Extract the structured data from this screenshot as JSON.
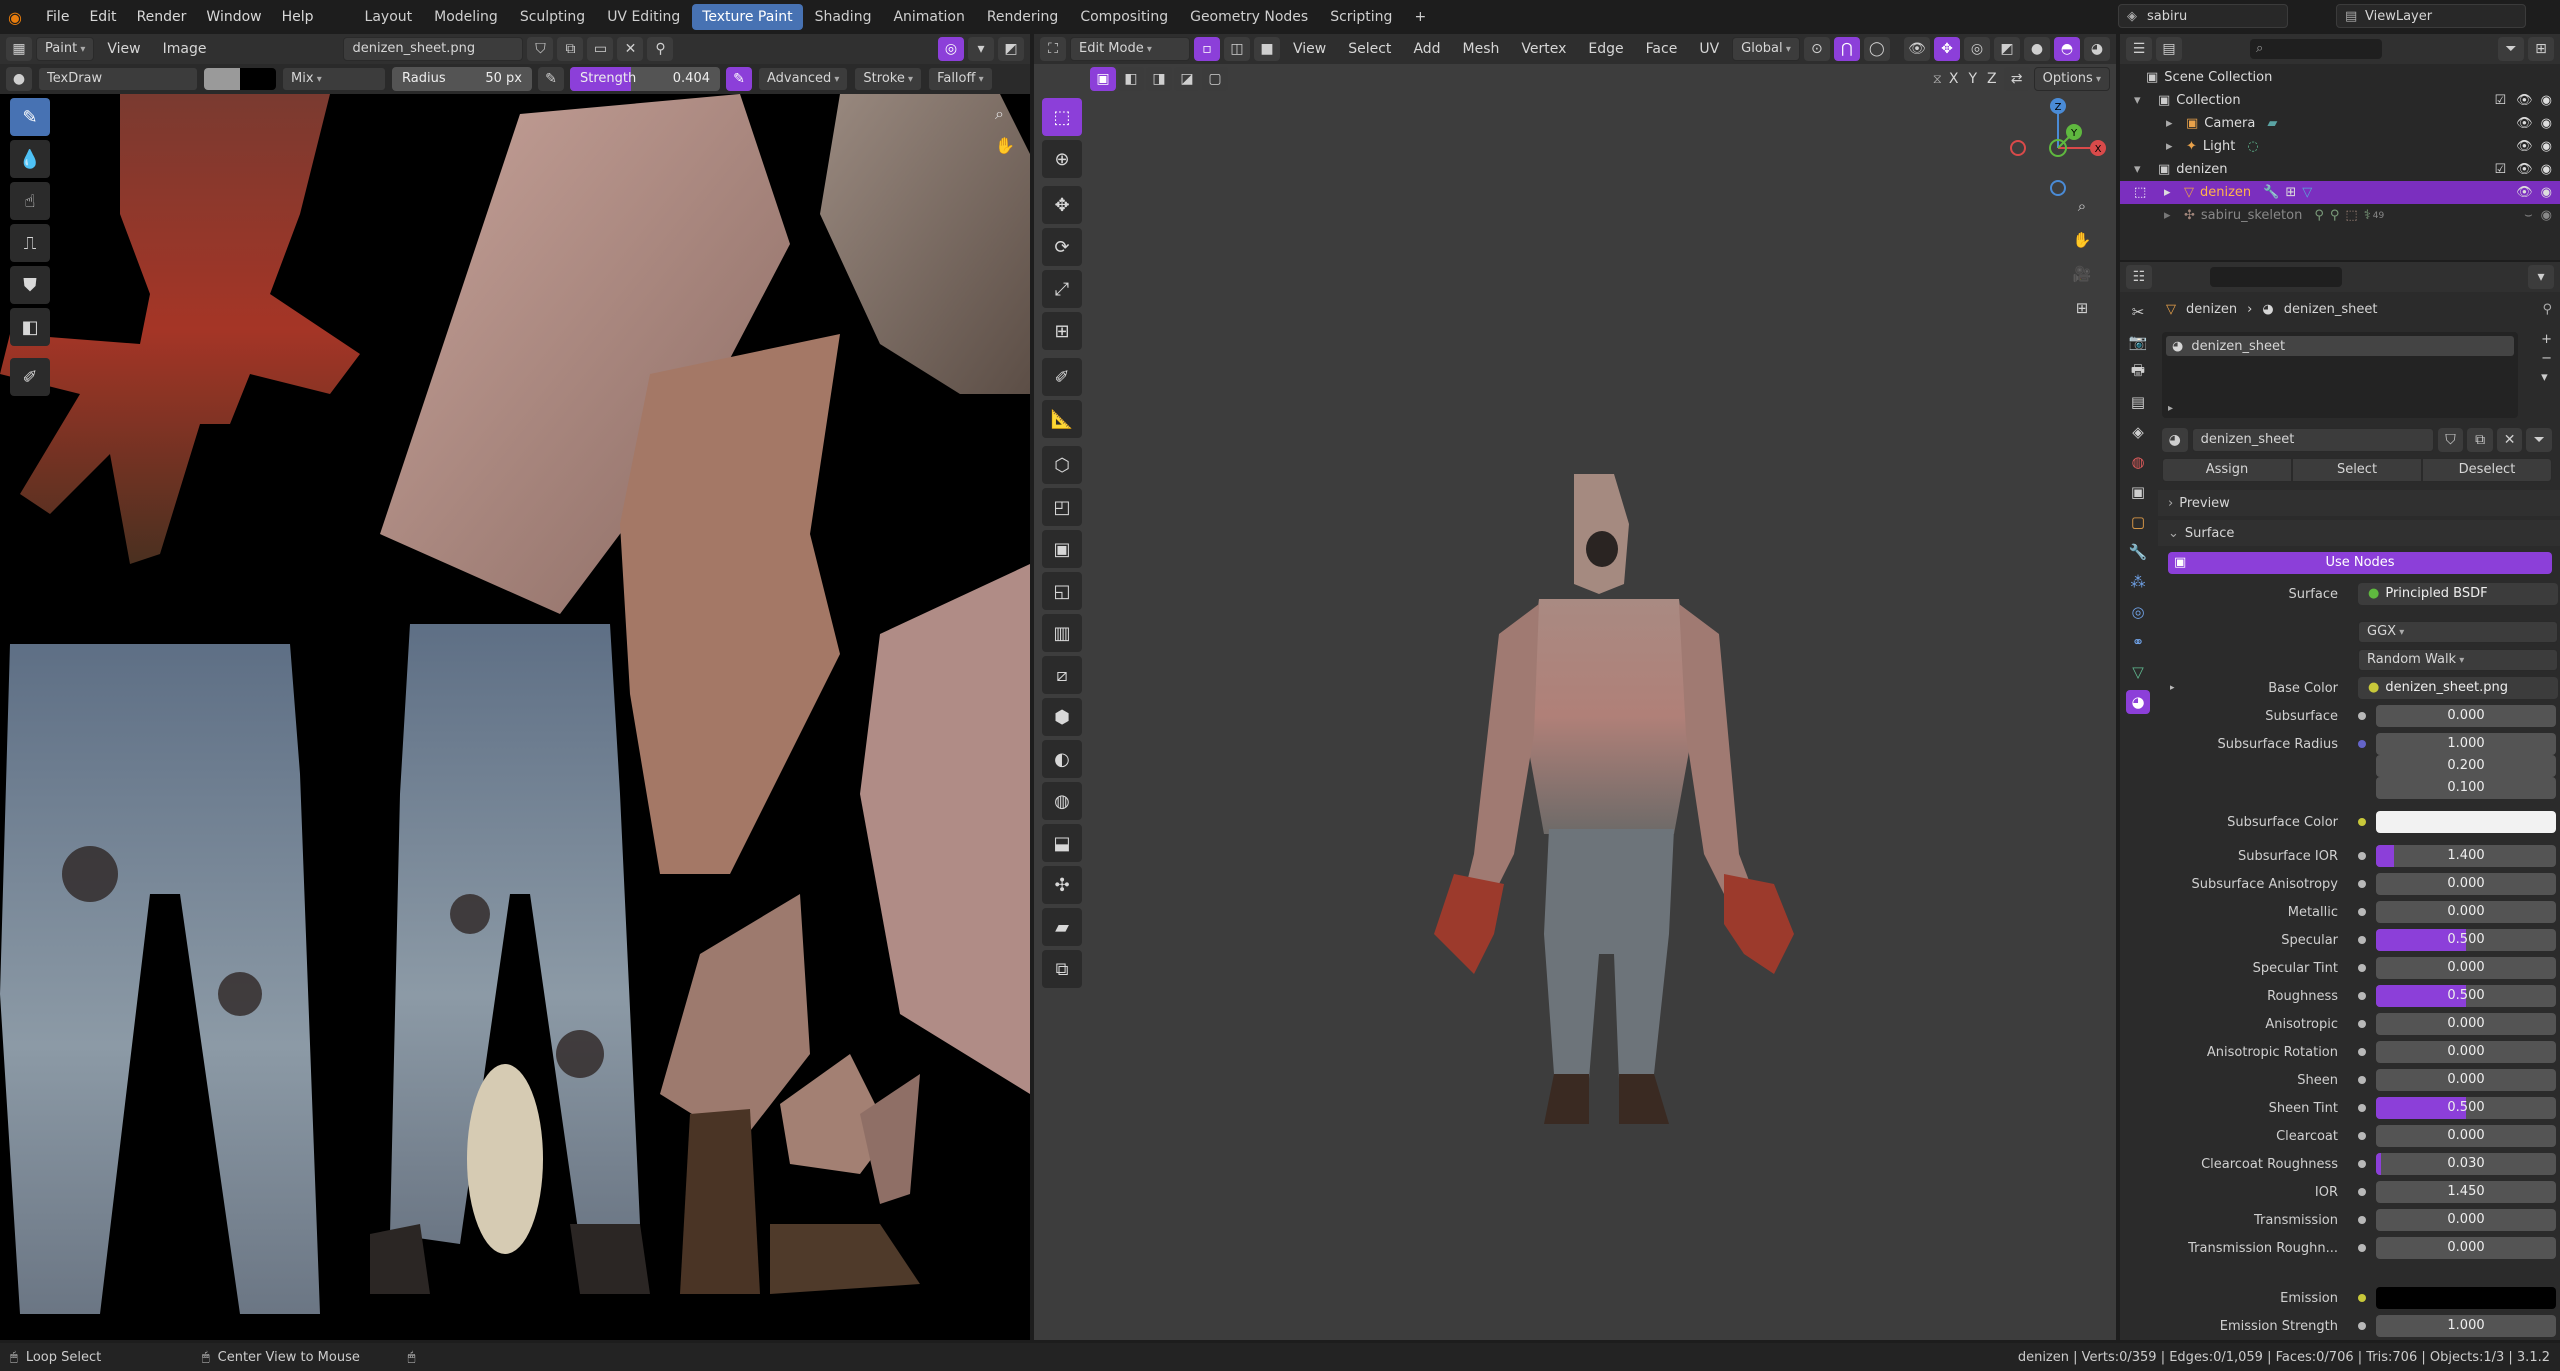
{
  "topbar": {
    "menu": [
      "File",
      "Edit",
      "Render",
      "Window",
      "Help"
    ],
    "workspaces": [
      "Layout",
      "Modeling",
      "Sculpting",
      "UV Editing",
      "Texture Paint",
      "Shading",
      "Animation",
      "Rendering",
      "Compositing",
      "Geometry Nodes",
      "Scripting"
    ],
    "active_workspace": "Texture Paint",
    "add_tab": "+",
    "scene": "sabiru",
    "view_layer": "ViewLayer"
  },
  "image_editor": {
    "mode": "Paint",
    "menu": [
      "View",
      "Image"
    ],
    "image_name": "denizen_sheet.png",
    "brush_name": "TexDraw",
    "blend": "Mix",
    "radius_label": "Radius",
    "radius_value": "50 px",
    "strength_label": "Strength",
    "strength_value": "0.404",
    "strength_fraction": 0.404,
    "advanced": "Advanced",
    "stroke": "Stroke",
    "falloff": "Falloff"
  },
  "viewport": {
    "mode": "Edit Mode",
    "menu": [
      "View",
      "Select",
      "Add",
      "Mesh",
      "Vertex",
      "Edge",
      "Face",
      "UV"
    ],
    "orientation": "Global",
    "axes": [
      "X",
      "Y",
      "Z"
    ],
    "options": "Options",
    "gizmo": {
      "x": "X",
      "y": "Y",
      "z": "Z"
    }
  },
  "outliner": {
    "search_placeholder": "",
    "rows": [
      {
        "label": "Scene Collection",
        "level": 0
      },
      {
        "label": "Collection",
        "level": 1
      },
      {
        "label": "Camera",
        "level": 2
      },
      {
        "label": "Light",
        "level": 2
      },
      {
        "label": "denizen",
        "level": 1
      },
      {
        "label": "denizen",
        "level": 2,
        "selected": true
      },
      {
        "label": "sabiru_skeleton",
        "level": 2,
        "dim": true
      }
    ],
    "skeleton_badge": "49"
  },
  "properties": {
    "breadcrumb": [
      "denizen",
      "denizen_sheet"
    ],
    "material_slot": "denizen_sheet",
    "material_name": "denizen_sheet",
    "assign": "Assign",
    "select": "Select",
    "deselect": "Deselect",
    "preview_panel": "Preview",
    "surface_panel": "Surface",
    "use_nodes": "Use Nodes",
    "surface_label": "Surface",
    "surface_value": "Principled BSDF",
    "distribution": "GGX",
    "subsurface_method": "Random Walk",
    "base_color_label": "Base Color",
    "base_color_value": "denizen_sheet.png",
    "subsurface_radius_label": "Subsurface Radius",
    "subsurface_radius": [
      "1.000",
      "0.200",
      "0.100"
    ],
    "subsurface_color_label": "Subsurface Color",
    "fields": [
      {
        "label": "Subsurface",
        "value": "0.000",
        "fill": 0
      },
      {
        "label": "Subsurface IOR",
        "value": "1.400",
        "fill": 0.1
      },
      {
        "label": "Subsurface Anisotropy",
        "value": "0.000",
        "fill": 0
      },
      {
        "label": "Metallic",
        "value": "0.000",
        "fill": 0
      },
      {
        "label": "Specular",
        "value": "0.500",
        "fill": 0.5
      },
      {
        "label": "Specular Tint",
        "value": "0.000",
        "fill": 0
      },
      {
        "label": "Roughness",
        "value": "0.500",
        "fill": 0.5
      },
      {
        "label": "Anisotropic",
        "value": "0.000",
        "fill": 0
      },
      {
        "label": "Anisotropic Rotation",
        "value": "0.000",
        "fill": 0
      },
      {
        "label": "Sheen",
        "value": "0.000",
        "fill": 0
      },
      {
        "label": "Sheen Tint",
        "value": "0.500",
        "fill": 0.5
      },
      {
        "label": "Clearcoat",
        "value": "0.000",
        "fill": 0
      },
      {
        "label": "Clearcoat Roughness",
        "value": "0.030",
        "fill": 0.03
      },
      {
        "label": "IOR",
        "value": "1.450",
        "fill": 0
      },
      {
        "label": "Transmission",
        "value": "0.000",
        "fill": 0
      },
      {
        "label": "Transmission Roughn...",
        "value": "0.000",
        "fill": 0
      }
    ],
    "emission_label": "Emission",
    "emission_strength_label": "Emission Strength",
    "emission_strength_value": "1.000"
  },
  "statusbar": {
    "left": "Loop Select",
    "middle": "Center View to Mouse",
    "right": "denizen | Verts:0/359 | Edges:0/1,059 | Faces:0/706 | Tris:706 | Objects:1/3 | 3.1.2"
  },
  "colors": {
    "accent": "#4772b3",
    "active_purple": "#8c3fd9"
  }
}
